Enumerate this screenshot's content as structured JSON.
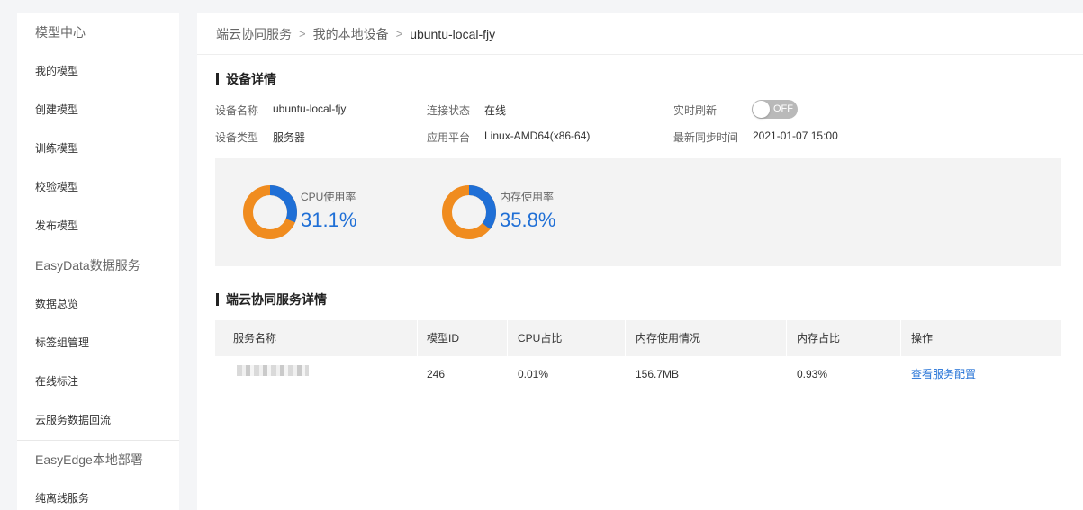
{
  "sidebar": {
    "groups": [
      {
        "title": "模型中心",
        "items": [
          "我的模型",
          "创建模型",
          "训练模型",
          "校验模型",
          "发布模型"
        ]
      },
      {
        "title": "EasyData数据服务",
        "items": [
          "数据总览",
          "标签组管理",
          "在线标注",
          "云服务数据回流"
        ]
      },
      {
        "title": "EasyEdge本地部署",
        "items": [
          "纯离线服务"
        ]
      }
    ]
  },
  "breadcrumb": [
    "端云协同服务",
    "我的本地设备",
    "ubuntu-local-fjy"
  ],
  "device": {
    "section_title": "设备详情",
    "name_label": "设备名称",
    "name_value": "ubuntu-local-fjy",
    "type_label": "设备类型",
    "type_value": "服务器",
    "conn_label": "连接状态",
    "conn_value": "在线",
    "platform_label": "应用平台",
    "platform_value": "Linux-AMD64(x86-64)",
    "refresh_label": "实时刷新",
    "refresh_state": "OFF",
    "sync_label": "最新同步时间",
    "sync_value": "2021-01-07 15:00"
  },
  "stats": {
    "cpu": {
      "label": "CPU使用率",
      "value": "31.1%",
      "fraction": 0.311
    },
    "mem": {
      "label": "内存使用率",
      "value": "35.8%",
      "fraction": 0.358
    },
    "colors": {
      "used": "#1f6fd6",
      "rest": "#f08c1f"
    }
  },
  "services": {
    "section_title": "端云协同服务详情",
    "columns": [
      "服务名称",
      "模型ID",
      "CPU占比",
      "内存使用情况",
      "内存占比",
      "操作"
    ],
    "rows": [
      {
        "model_id": "246",
        "cpu": "0.01%",
        "mem_usage": "156.7MB",
        "mem_ratio": "0.93%",
        "action": "查看服务配置"
      }
    ]
  }
}
